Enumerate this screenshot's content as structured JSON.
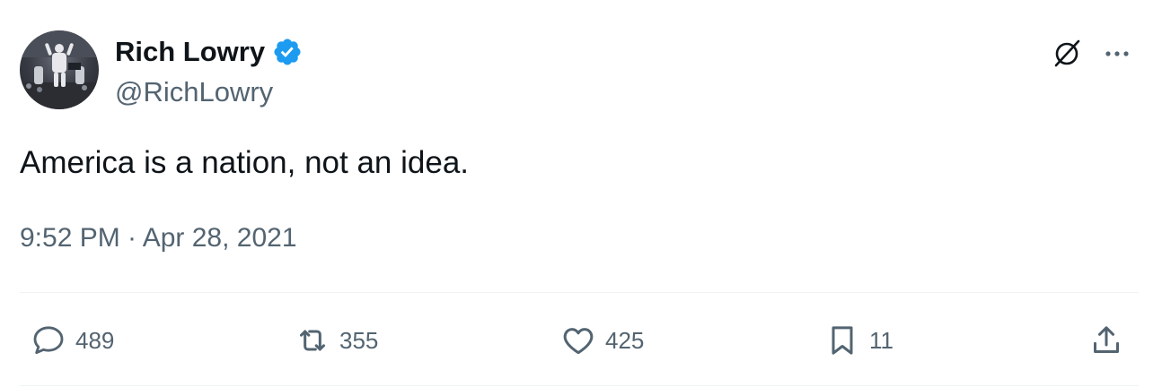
{
  "author": {
    "name": "Rich Lowry",
    "handle": "@RichLowry",
    "verified": true
  },
  "tweet": {
    "text": "America is a nation, not an idea.",
    "timestamp": "9:52 PM · Apr 28, 2021"
  },
  "stats": {
    "replies": "489",
    "retweets": "355",
    "likes": "425",
    "bookmarks": "11"
  },
  "colors": {
    "text": "#0f1419",
    "secondary": "#536471",
    "verified": "#1d9bf0",
    "divider": "#eff3f4"
  },
  "icons": [
    "grok-icon",
    "more-icon",
    "reply-icon",
    "retweet-icon",
    "like-icon",
    "bookmark-icon",
    "share-icon",
    "verified-badge-icon"
  ]
}
